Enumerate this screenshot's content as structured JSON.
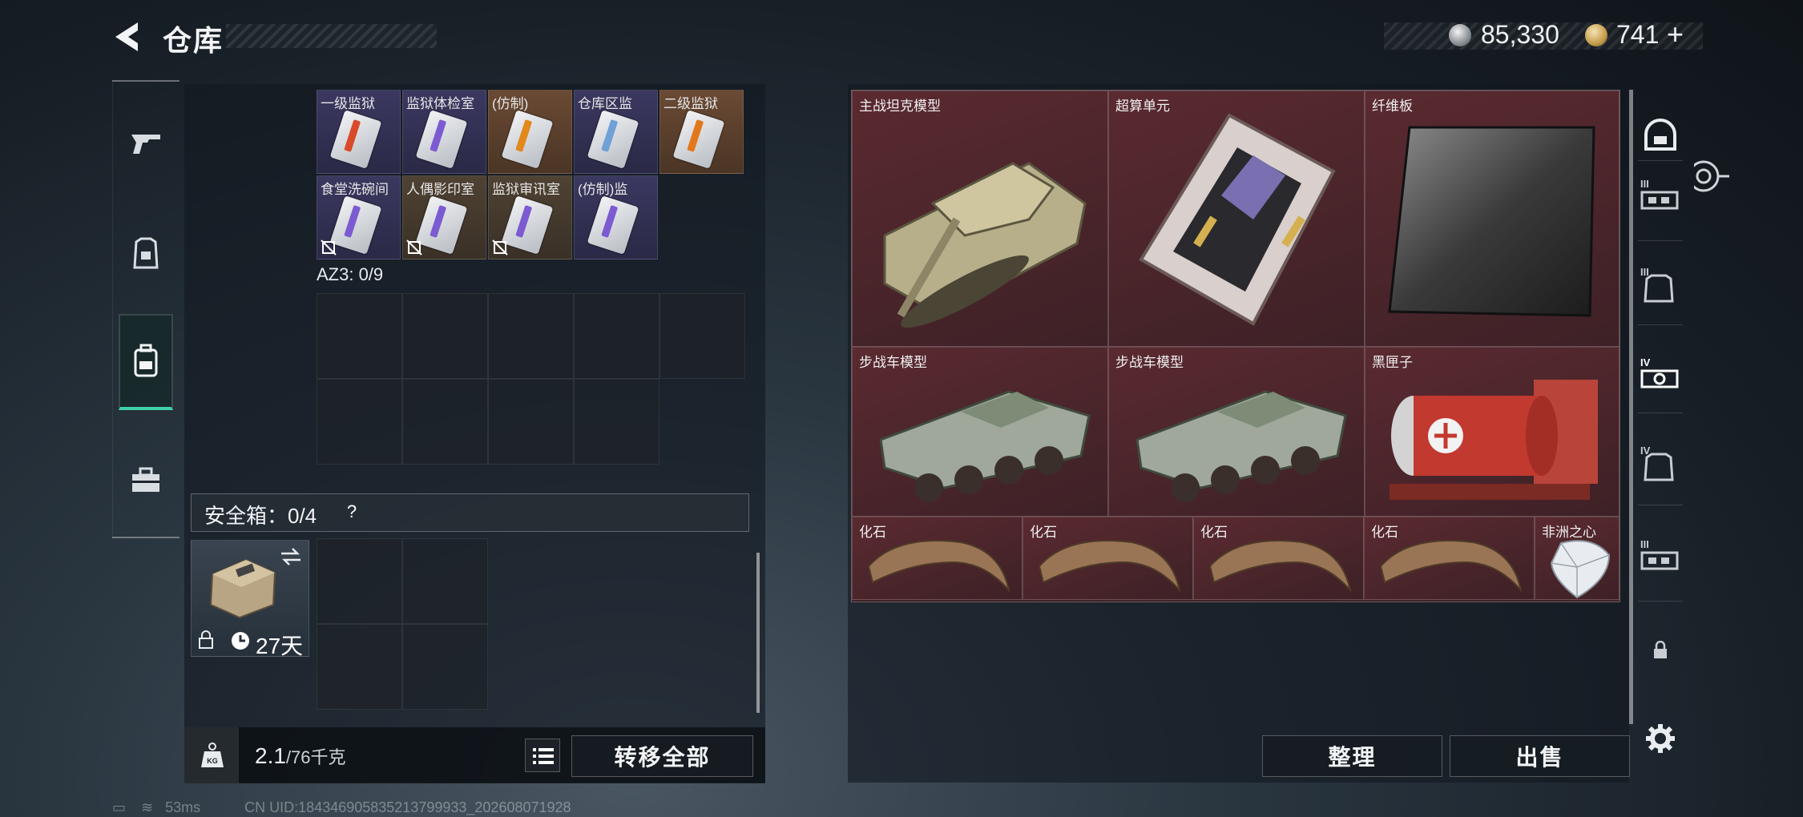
{
  "header": {
    "title": "仓库",
    "currency_silver": "85,330",
    "currency_gold": "741",
    "add_label": "+"
  },
  "left_tabs": [
    {
      "name": "weapons",
      "icon": "gun-icon",
      "active": false
    },
    {
      "name": "equipment",
      "icon": "armor-icon",
      "active": false
    },
    {
      "name": "backpack",
      "icon": "backpack-icon",
      "active": true
    },
    {
      "name": "medical",
      "icon": "toolbox-icon",
      "active": false
    }
  ],
  "keycards": [
    {
      "label": "一级监狱",
      "color": "purple",
      "stripe": "#d94a2b",
      "locked": false
    },
    {
      "label": "监狱体检室",
      "color": "purple",
      "stripe": "#7c5ad1",
      "locked": false
    },
    {
      "label": "(仿制)",
      "color": "orange",
      "stripe": "#e2881c",
      "locked": false
    },
    {
      "label": "仓库区监",
      "color": "purple",
      "stripe": "#6fa0d6",
      "locked": false
    },
    {
      "label": "二级监狱",
      "color": "orange",
      "stripe": "#e2781c",
      "locked": false
    },
    {
      "label": "食堂洗碗间",
      "color": "purple",
      "stripe": "#7c5ad1",
      "locked": true
    },
    {
      "label": "人偶影印室",
      "color": "brown",
      "stripe": "#7c5ad1",
      "locked": true
    },
    {
      "label": "监狱审讯室",
      "color": "brown",
      "stripe": "#7c5ad1",
      "locked": true
    },
    {
      "label": "(仿制)监",
      "color": "purple",
      "stripe": "#7c5ad1",
      "locked": false
    }
  ],
  "az3": {
    "label": "AZ3: 0/9"
  },
  "safe_box": {
    "label": "安全箱：0/4",
    "help": "?",
    "days": "27天"
  },
  "weight": {
    "current": "2.1",
    "max": "/76千克"
  },
  "buttons": {
    "transfer_all": "转移全部",
    "sort": "整理",
    "sell": "出售"
  },
  "items": [
    {
      "label": "主战坦克模型",
      "kind": "tank"
    },
    {
      "label": "超算单元",
      "kind": "board"
    },
    {
      "label": "纤维板",
      "kind": "plate"
    },
    {
      "label": "步战车模型",
      "kind": "ifv"
    },
    {
      "label": "步战车模型",
      "kind": "ifv"
    },
    {
      "label": "黑匣子",
      "kind": "blackbox"
    },
    {
      "label": "化石",
      "kind": "fossil"
    },
    {
      "label": "化石",
      "kind": "fossil"
    },
    {
      "label": "化石",
      "kind": "fossil"
    },
    {
      "label": "化石",
      "kind": "fossil"
    },
    {
      "label": "非洲之心",
      "kind": "diamond"
    }
  ],
  "right_rail": [
    {
      "icon": "helmet-icon",
      "tier": ""
    },
    {
      "icon": "rig-icon",
      "tier": "III"
    },
    {
      "icon": "armor-icon",
      "tier": "III"
    },
    {
      "icon": "rig-icon",
      "tier": "IV"
    },
    {
      "icon": "armor-icon",
      "tier": "IV"
    },
    {
      "icon": "rig-icon",
      "tier": "III"
    },
    {
      "icon": "lock-icon",
      "tier": ""
    },
    {
      "icon": "gear-icon",
      "tier": ""
    }
  ],
  "status": {
    "ping": "53ms",
    "uid": "CN UID:184346905835213799933_202608071928"
  }
}
